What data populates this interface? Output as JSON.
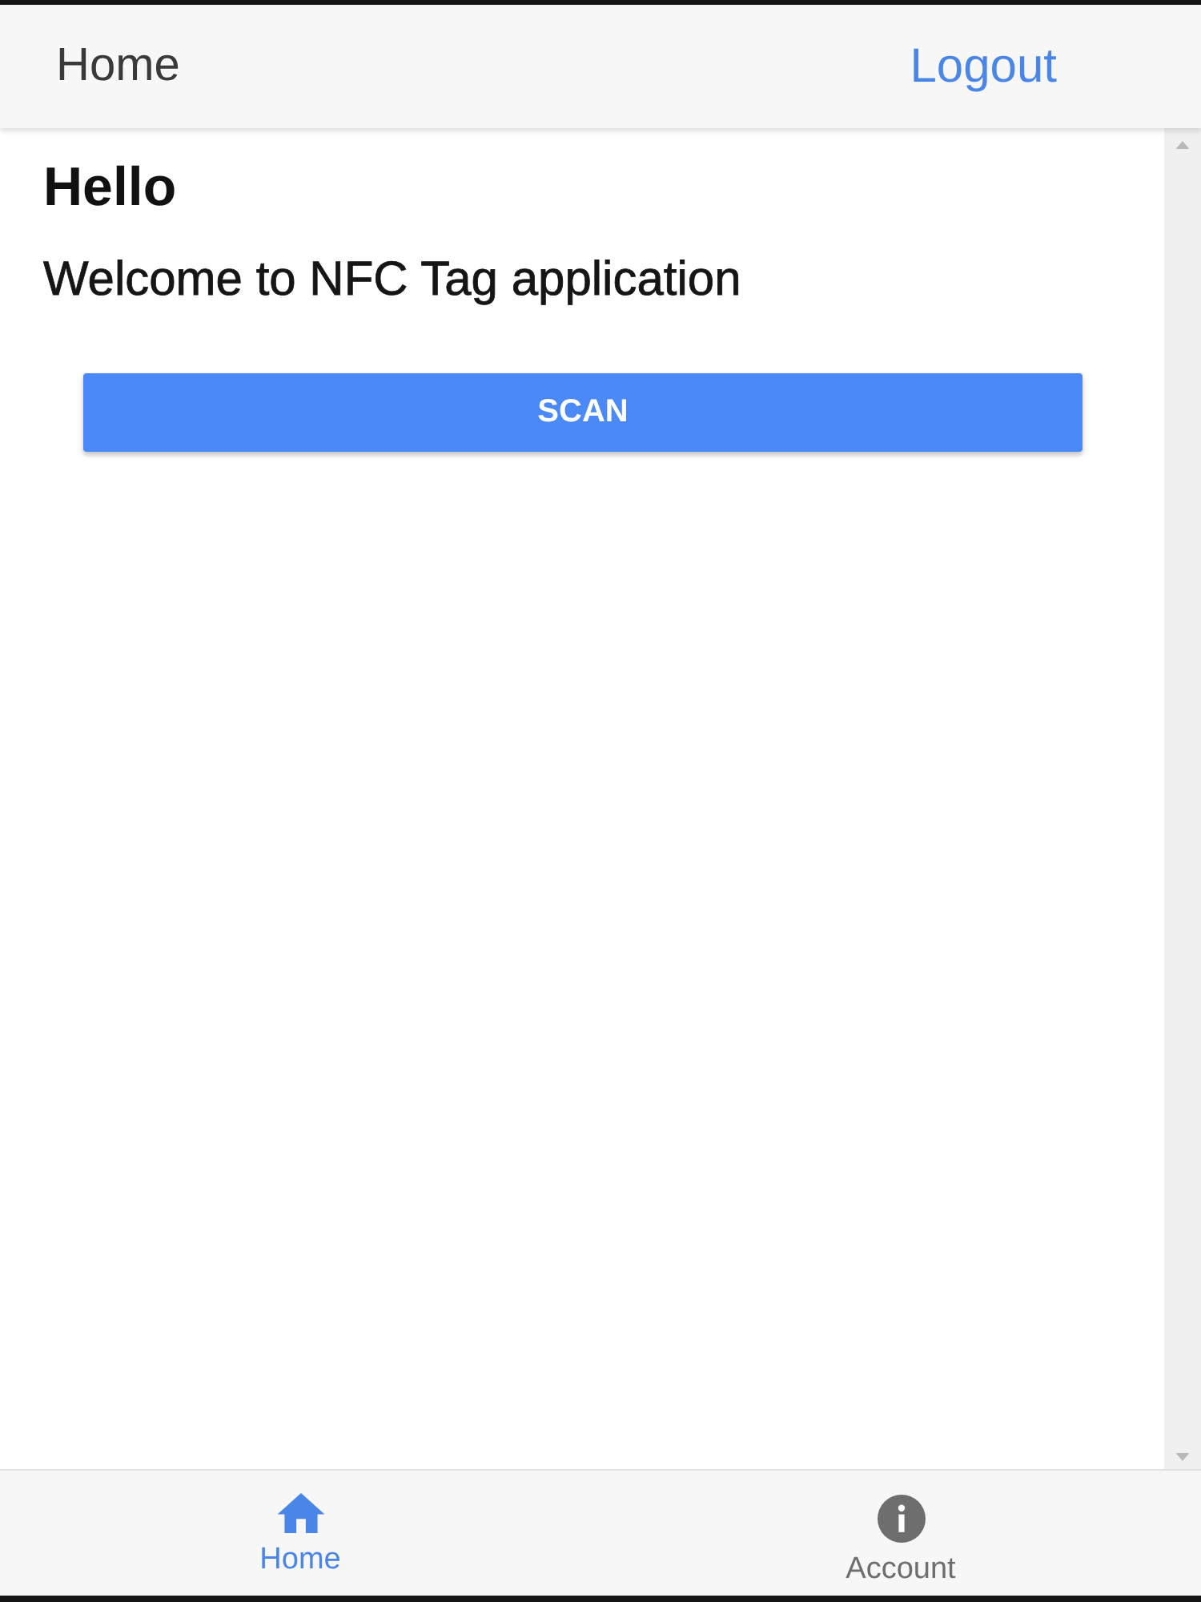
{
  "header": {
    "title": "Home",
    "action": "Logout"
  },
  "content": {
    "heading": "Hello",
    "message": "Welcome to NFC Tag application",
    "button": "SCAN"
  },
  "tab_bar": {
    "tabs": [
      {
        "label": "Home",
        "selected": true
      },
      {
        "label": "Account",
        "selected": false
      }
    ]
  }
}
